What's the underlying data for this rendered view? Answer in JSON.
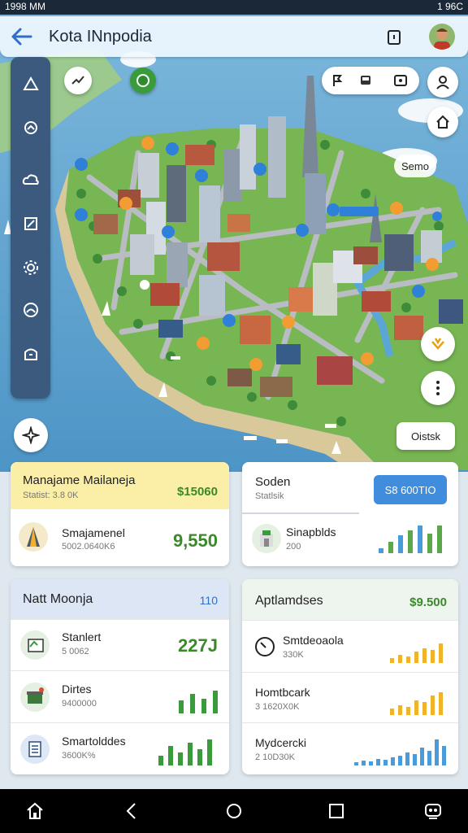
{
  "status_bar": {
    "time": "1998 MM",
    "right": "1 96C"
  },
  "app_bar": {
    "title": "Kota INnpodia"
  },
  "map": {
    "label_1": "Semo",
    "label_2": "Oistsk"
  },
  "cards": {
    "card1": {
      "title": "Manajame Mailaneja",
      "value": "$15060",
      "sub": "Statist: 3.8 0K",
      "row_label": "Smajamenel",
      "row_sub": "5002.0640K6",
      "row_value": "9,550"
    },
    "card2": {
      "title": "Soden",
      "sub": "Statlsik",
      "button": "S8 600TIO",
      "row_label": "Sinapblds",
      "row_sub": "200"
    },
    "card3": {
      "title": "Natt Moonja",
      "value": "110",
      "rows": [
        {
          "label": "Stanlert",
          "sub": "5 0062",
          "value": "227J"
        },
        {
          "label": "Dirtes",
          "sub": "9400000"
        },
        {
          "label": "Smartolddes",
          "sub": "3600K%"
        }
      ]
    },
    "card4": {
      "title": "Aptlamdses",
      "value": "$9.500",
      "rows": [
        {
          "label": "Smtdeoaola",
          "sub": "330K"
        },
        {
          "label": "Homtbcark",
          "sub": "3 1620X0K"
        },
        {
          "label": "Mydcercki",
          "sub": "2 10D30K"
        }
      ]
    }
  },
  "colors": {
    "accent_green": "#3a9b3a",
    "accent_blue": "#2f80d8",
    "rail": "#3b5a7e"
  }
}
